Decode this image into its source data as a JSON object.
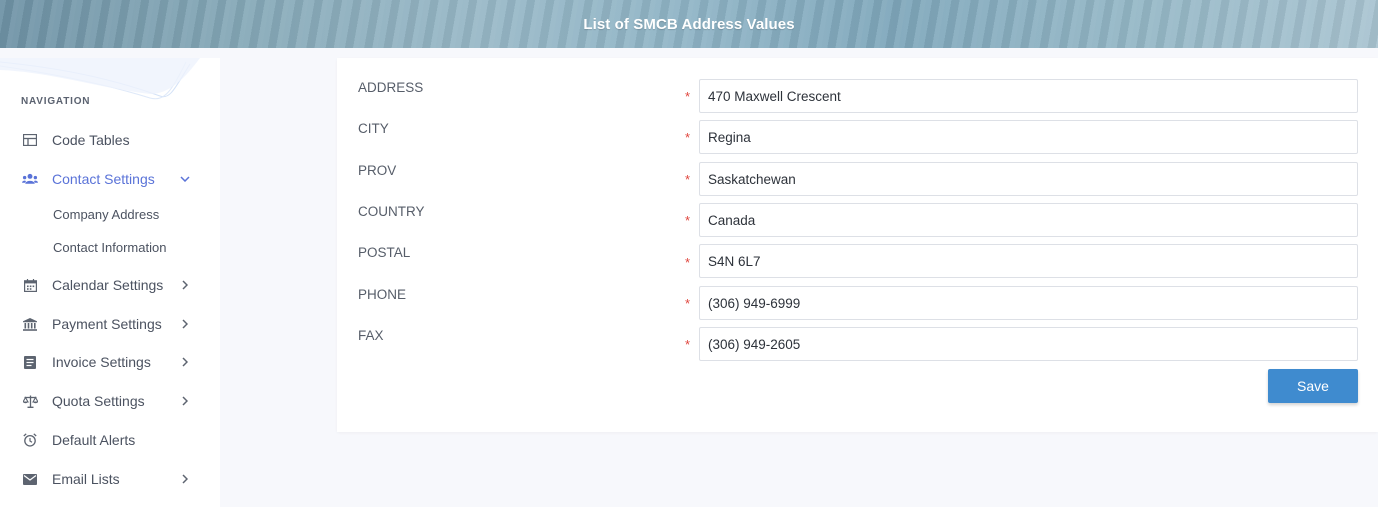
{
  "header": {
    "title": "List of SMCB Address Values"
  },
  "sidebar": {
    "caption": "NAVIGATION",
    "items": [
      {
        "label": "Code Tables",
        "icon": "table-icon",
        "chevron": false
      },
      {
        "label": "Contact Settings",
        "icon": "users-icon",
        "chevron": "down",
        "active": true,
        "children": [
          "Company Address",
          "Contact Information"
        ]
      },
      {
        "label": "Calendar Settings",
        "icon": "calendar-icon",
        "chevron": "right"
      },
      {
        "label": "Payment Settings",
        "icon": "bank-icon",
        "chevron": "right"
      },
      {
        "label": "Invoice Settings",
        "icon": "invoice-icon",
        "chevron": "right"
      },
      {
        "label": "Quota Settings",
        "icon": "scale-icon",
        "chevron": "right"
      },
      {
        "label": "Default Alerts",
        "icon": "alarm-icon",
        "chevron": false
      },
      {
        "label": "Email Lists",
        "icon": "mail-icon",
        "chevron": "right"
      }
    ]
  },
  "form": {
    "required_marker": "*",
    "fields": [
      {
        "label": "ADDRESS",
        "value": "470 Maxwell Crescent"
      },
      {
        "label": "CITY",
        "value": "Regina"
      },
      {
        "label": "PROV",
        "value": "Saskatchewan"
      },
      {
        "label": "COUNTRY",
        "value": "Canada"
      },
      {
        "label": "POSTAL",
        "value": "S4N 6L7"
      },
      {
        "label": "PHONE",
        "value": "(306) 949-6999"
      },
      {
        "label": "FAX",
        "value": "(306) 949-2605"
      }
    ],
    "save_label": "Save"
  },
  "colors": {
    "accent": "#5a73d8",
    "button": "#3f8bcf",
    "required": "#e0453d"
  }
}
